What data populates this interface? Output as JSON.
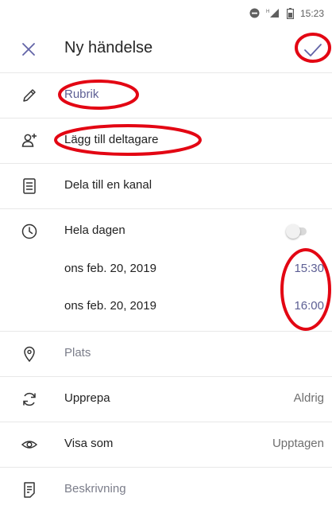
{
  "status": {
    "time": "15:23"
  },
  "header": {
    "title": "Ny händelse",
    "close_icon": "close-icon",
    "save_icon": "checkmark-icon"
  },
  "form": {
    "title_placeholder": "Rubrik",
    "add_participants": "Lägg till deltagare",
    "share_channel": "Dela till en kanal",
    "all_day": {
      "label": "Hela dagen",
      "on": false
    },
    "start": {
      "date": "ons feb. 20, 2019",
      "time": "15:30"
    },
    "end": {
      "date": "ons feb. 20, 2019",
      "time": "16:00"
    },
    "location_placeholder": "Plats",
    "repeat": {
      "label": "Upprepa",
      "value": "Aldrig"
    },
    "show_as": {
      "label": "Visa som",
      "value": "Upptagen"
    },
    "description_placeholder": "Beskrivning"
  },
  "colors": {
    "accent": "#6264a7",
    "annotation": "#e30613",
    "muted_text": "#7b7d8a"
  }
}
